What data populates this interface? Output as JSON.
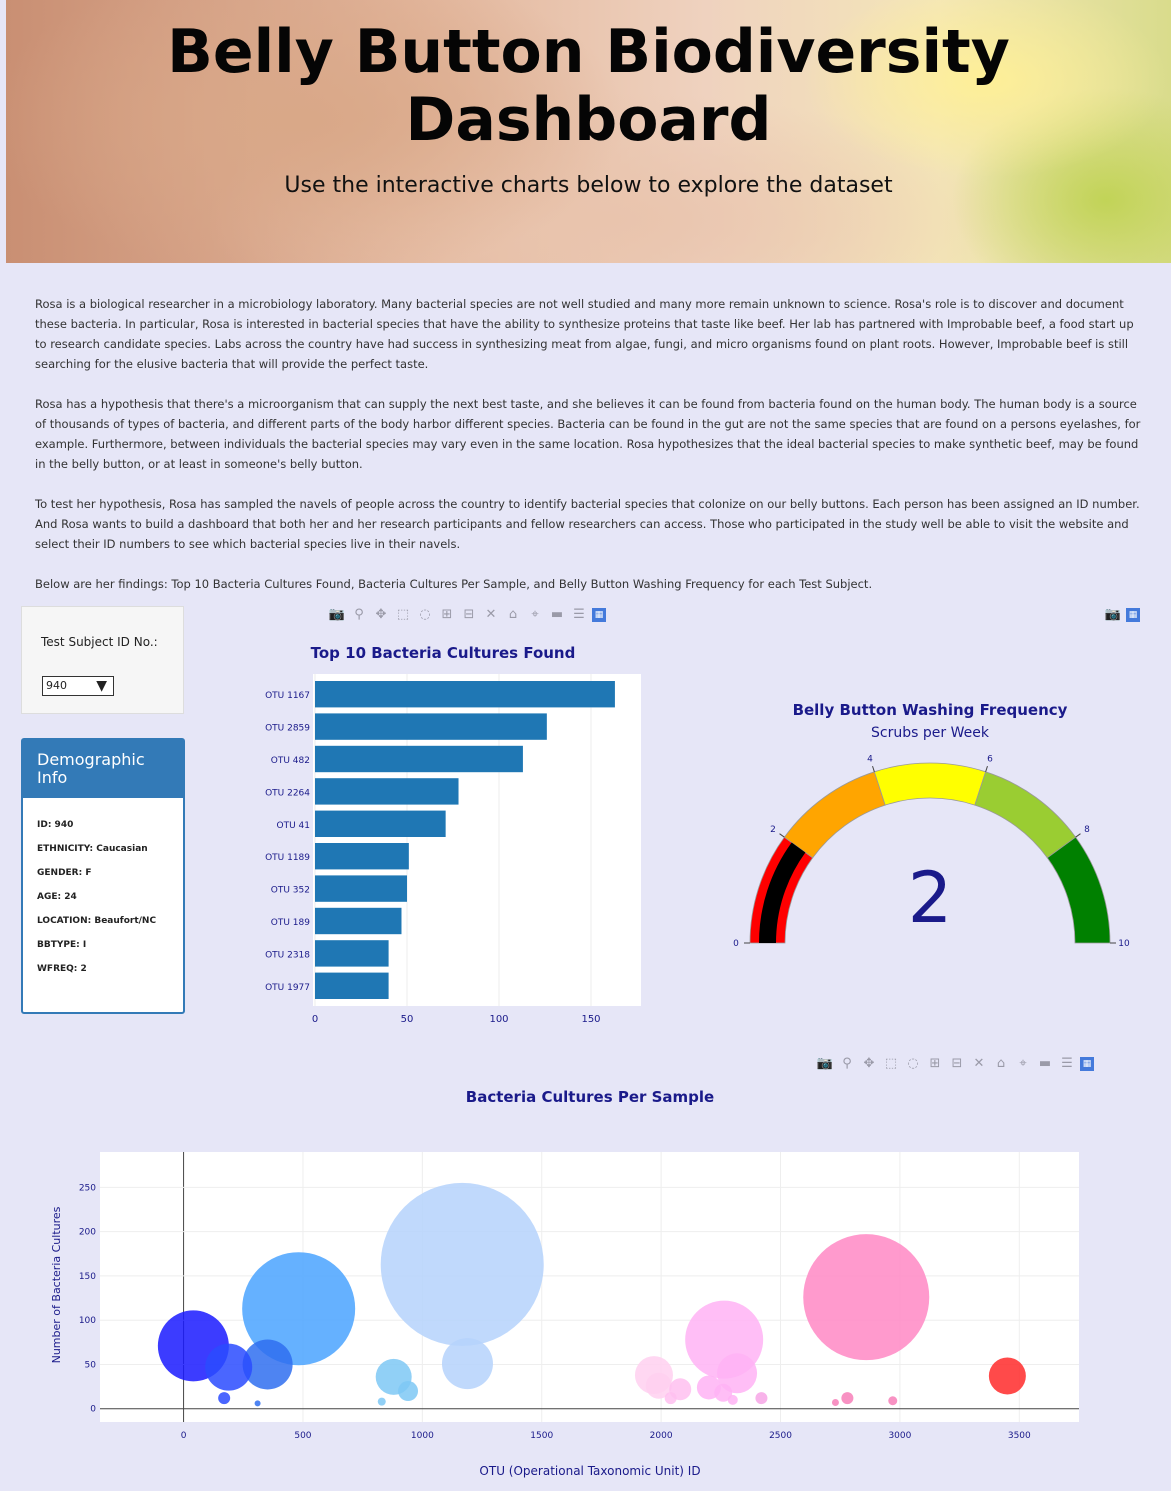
{
  "header": {
    "title": "Belly Button Biodiversity Dashboard",
    "subtitle": "Use the interactive charts below to explore the dataset"
  },
  "intro": {
    "paragraphs": [
      "Rosa is a biological researcher in a microbiology laboratory. Many bacterial species are not well studied and many more remain unknown to science. Rosa's role is to discover and document these bacteria. In particular, Rosa is interested in bacterial species that have the ability to synthesize proteins that taste like beef. Her lab has partnered with Improbable beef, a food start up to research candidate species. Labs across the country have had success in synthesizing meat from algae, fungi, and micro organisms found on plant roots. However, Improbable beef is still searching for the elusive bacteria that will provide the perfect taste.",
      "Rosa has a hypothesis that there's a microorganism that can supply the next best taste, and she believes it can be found from bacteria found on the human body. The human body is a source of thousands of types of bacteria, and different parts of the body harbor different species. Bacteria can be found in the gut are not the same species that are found on a persons eyelashes, for example. Furthermore, between individuals the bacterial species may vary even in the same location. Rosa hypothesizes that the ideal bacterial species to make synthetic beef, may be found in the belly button, or at least in someone's belly button.",
      "To test her hypothesis, Rosa has sampled the navels of people across the country to identify bacterial species that colonize on our belly buttons. Each person has been assigned an ID number. And Rosa wants to build a dashboard that both her and her research participants and fellow researchers can access. Those who participated in the study well be able to visit the website and select their ID numbers to see which bacterial species live in their navels.",
      "Below are her findings: Top 10 Bacteria Cultures Found, Bacteria Cultures Per Sample, and Belly Button Washing Frequency for each Test Subject."
    ]
  },
  "selector": {
    "label": "Test Subject ID No.:",
    "selected": "940"
  },
  "demographics": {
    "title": "Demographic Info",
    "rows": [
      "ID: 940",
      "ETHNICITY: Caucasian",
      "GENDER: F",
      "AGE: 24",
      "LOCATION: Beaufort/NC",
      "BBTYPE: I",
      "WFREQ: 2"
    ]
  },
  "colors": {
    "bar": "#1f77b4",
    "gauge_bands": [
      "#ff0000",
      "#000000",
      "#ffa500",
      "#ffff00",
      "#9acd32",
      "#008000"
    ],
    "panel_header": "#337ab7",
    "title_text": "#1a1a8a"
  },
  "chart_data": [
    {
      "type": "bar",
      "title": "Top 10 Bacteria Cultures Found",
      "orientation": "horizontal",
      "categories": [
        "OTU 1167",
        "OTU 2859",
        "OTU 482",
        "OTU 2264",
        "OTU 41",
        "OTU 1189",
        "OTU 352",
        "OTU 189",
        "OTU 2318",
        "OTU 1977"
      ],
      "values": [
        163,
        126,
        113,
        78,
        71,
        51,
        50,
        47,
        40,
        40
      ],
      "xlim": [
        0,
        175
      ],
      "xticks": [
        0,
        50,
        100,
        150
      ]
    },
    {
      "type": "gauge",
      "title": "Belly Button Washing Frequency",
      "subtitle": "Scrubs per Week",
      "value": 2,
      "range": [
        0,
        10
      ],
      "tick_labels": [
        "0",
        "2",
        "4",
        "6",
        "8",
        "10"
      ],
      "bands": [
        {
          "from": 0,
          "to": 2
        },
        {
          "from": 2,
          "to": 4
        },
        {
          "from": 4,
          "to": 6
        },
        {
          "from": 6,
          "to": 8
        },
        {
          "from": 8,
          "to": 10
        }
      ]
    },
    {
      "type": "scatter",
      "title": "Bacteria Cultures Per Sample",
      "xlabel": "OTU (Operational Taxonomic Unit) ID",
      "ylabel": "Number of Bacteria Cultures",
      "xlim": [
        -350,
        3750
      ],
      "ylim": [
        -15,
        290
      ],
      "xticks": [
        0,
        500,
        1000,
        1500,
        2000,
        2500,
        3000,
        3500
      ],
      "yticks": [
        0,
        50,
        100,
        150,
        200,
        250
      ],
      "points": [
        {
          "x": 41,
          "y": 71,
          "color": "#1a1aff"
        },
        {
          "x": 189,
          "y": 47,
          "color": "#2a4bff"
        },
        {
          "x": 352,
          "y": 50,
          "color": "#2f6ff0"
        },
        {
          "x": 482,
          "y": 113,
          "color": "#4aa3ff"
        },
        {
          "x": 170,
          "y": 12,
          "color": "#2a4bff"
        },
        {
          "x": 310,
          "y": 6,
          "color": "#2f6ff0"
        },
        {
          "x": 880,
          "y": 36,
          "color": "#7ec8f5"
        },
        {
          "x": 940,
          "y": 20,
          "color": "#7ec8f5"
        },
        {
          "x": 830,
          "y": 8,
          "color": "#7ec8f5"
        },
        {
          "x": 1167,
          "y": 163,
          "color": "#b5d2fb"
        },
        {
          "x": 1189,
          "y": 51,
          "color": "#b5d2fb"
        },
        {
          "x": 1970,
          "y": 38,
          "color": "#ffd0f0"
        },
        {
          "x": 1990,
          "y": 26,
          "color": "#ffd0f0"
        },
        {
          "x": 2080,
          "y": 22,
          "color": "#ffbff0"
        },
        {
          "x": 2040,
          "y": 12,
          "color": "#ffbff0"
        },
        {
          "x": 2264,
          "y": 78,
          "color": "#ffb3f5"
        },
        {
          "x": 2318,
          "y": 40,
          "color": "#ffb3f5"
        },
        {
          "x": 2200,
          "y": 24,
          "color": "#ffb3f5"
        },
        {
          "x": 2260,
          "y": 18,
          "color": "#ffb3f5"
        },
        {
          "x": 2300,
          "y": 10,
          "color": "#ffb3f5"
        },
        {
          "x": 2420,
          "y": 12,
          "color": "#f7a6e6"
        },
        {
          "x": 2859,
          "y": 126,
          "color": "#ff88c4"
        },
        {
          "x": 2780,
          "y": 12,
          "color": "#f77fb8"
        },
        {
          "x": 2730,
          "y": 7,
          "color": "#f77fb8"
        },
        {
          "x": 2970,
          "y": 9,
          "color": "#f77fb8"
        },
        {
          "x": 3450,
          "y": 37,
          "color": "#ff2a2a"
        }
      ]
    }
  ]
}
